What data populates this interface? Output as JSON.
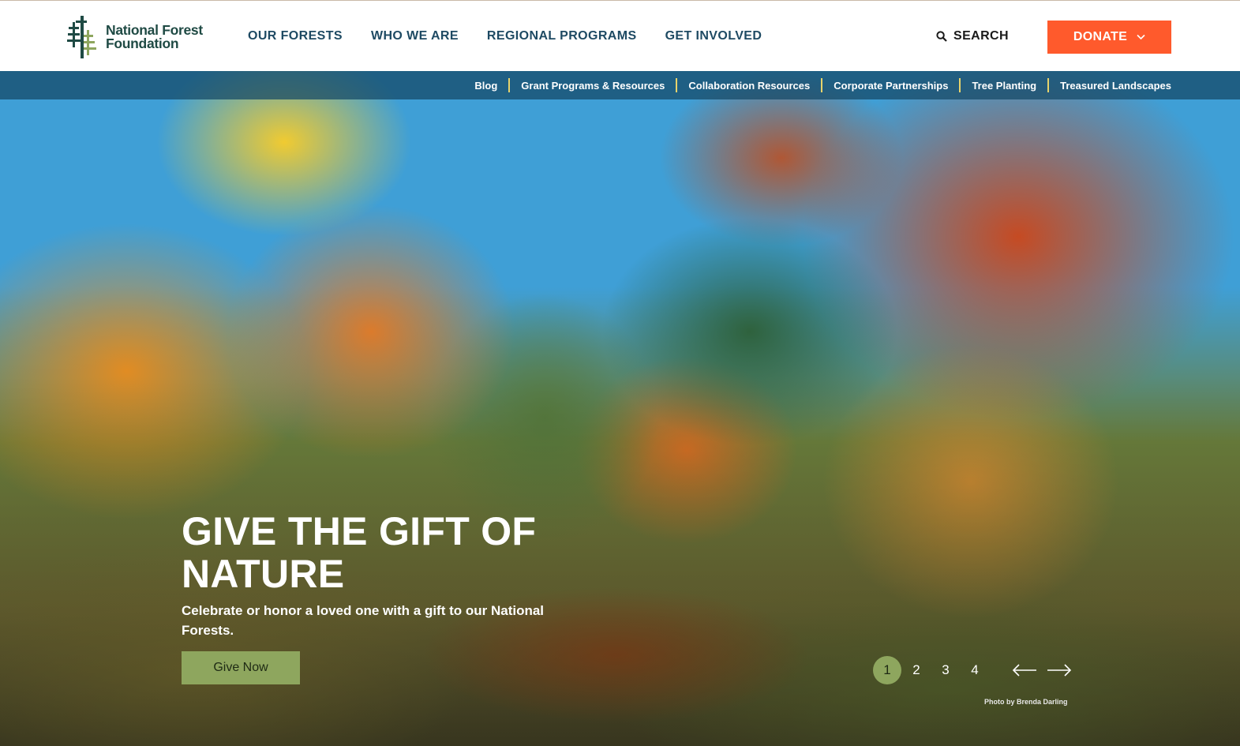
{
  "header": {
    "logo": {
      "line1": "National Forest",
      "line2": "Foundation",
      "icon": "tree-logo-icon"
    },
    "nav": [
      "OUR FORESTS",
      "WHO WE ARE",
      "REGIONAL PROGRAMS",
      "GET INVOLVED"
    ],
    "search_label": "SEARCH",
    "donate_label": "DONATE"
  },
  "subnav": [
    "Blog",
    "Grant Programs & Resources",
    "Collaboration Resources",
    "Corporate Partnerships",
    "Tree Planting",
    "Treasured Landscapes"
  ],
  "hero": {
    "title_line1": "GIVE THE GIFT OF",
    "title_line2": "NATURE",
    "text": "Celebrate or honor a loved one with a gift to our National Forests.",
    "button_label": "Give Now",
    "pages": [
      "1",
      "2",
      "3",
      "4"
    ],
    "active_page": "1",
    "credit": "Photo by Brenda Darling"
  },
  "colors": {
    "donate": "#ff5a2c",
    "accent_green": "#8ea65e",
    "nav_blue": "#1e4a63",
    "logo_green": "#1f4a44"
  }
}
